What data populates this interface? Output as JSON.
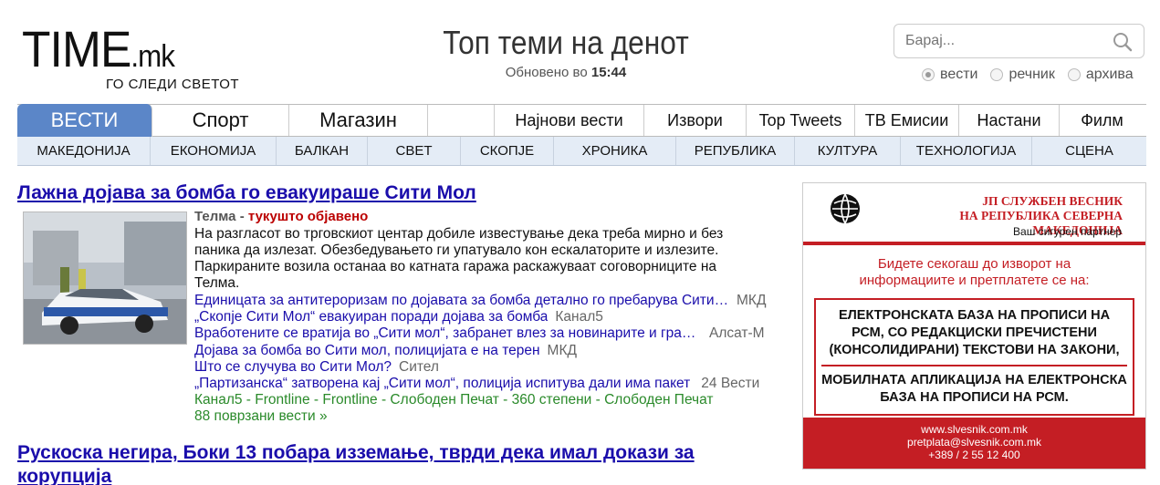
{
  "header": {
    "logo_main": "TIME",
    "logo_mk": ".mk",
    "logo_tagline": "ГО СЛЕДИ СВЕТОТ",
    "page_title": "Топ теми на денот",
    "updated_label": "Обновено во",
    "updated_time": "15:44",
    "search_placeholder": "Барај...",
    "radio_news": "вести",
    "radio_dictionary": "речник",
    "radio_archive": "архива"
  },
  "nav": {
    "main": [
      "ВЕСТИ",
      "Спорт",
      "Магазин"
    ],
    "secondary": [
      "Најнови вести",
      "Извори",
      "Top Tweets",
      "ТВ Емисии",
      "Настани",
      "Филм"
    ],
    "sub": [
      "МАКЕДОНИЈА",
      "ЕКОНОМИЈА",
      "БАЛКАН",
      "СВЕТ",
      "СКОПЈЕ",
      "ХРОНИКА",
      "РЕПУБЛИКА",
      "КУЛТУРА",
      "ТЕХНОЛОГИЈА",
      "СЦЕНА"
    ]
  },
  "article1": {
    "headline": "Лажна дојава за бомба го евакуираше Сити Мол",
    "source": "Телма",
    "source_sep": " - ",
    "recency": "тукушто објавено",
    "summary": "На разгласот во трговскиот центар добиле известување дека треба мирно и без паника да излезат. Обезбедувањето ги упатувало кон ескалаторите и излезите. Паркираните возила останаа во катната гаража раскажуваат соговорниците на Телма.",
    "related": [
      {
        "title": "Единицата за антитероризам по дојавата за бомба детално го пребарува Сити Мол",
        "source": "МКД"
      },
      {
        "title": "„Скопје Сити Мол“ евакуиран поради дојава за бомба",
        "source": "Канал5"
      },
      {
        "title": "Вработените се вратија во „Сити мол“, забранет влез за новинарите и граѓаните",
        "source": "Алсат-М"
      },
      {
        "title": "Дојава за бомба во Сити мол, полицијата е на терен",
        "source": "МКД"
      },
      {
        "title": "Што се случува во Сити Мол?",
        "source": "Сител"
      },
      {
        "title": "„Партизанска“ затворена кај „Сити мол“, полиција испитува дали има пакет",
        "source": "24 Вести"
      }
    ],
    "more_sources": "Канал5 - Frontline - Frontline - Слободен Печат - 360 степени - Слободен Печат",
    "more_count": "88 поврзани вести »",
    "thumb_label": "ПОЛИЦИЈА"
  },
  "article2": {
    "headline": "Рускоска негира, Боки 13 побара изземање, тврди дека имал докази за корупција"
  },
  "ad": {
    "title_line1": "ЈП СЛУЖБЕН ВЕСНИК",
    "title_line2": "НА РЕПУБЛИКА СЕВЕРНА МАКЕДОНИЈА",
    "slogan": "Ваш сигурен партнер",
    "red_line1": "Бидете секогаш до изворот на",
    "red_line2": "информациите и претплатете се на:",
    "box_text1": "ЕЛЕКТРОНСКАТА БАЗА НА ПРОПИСИ НА РСМ, СО РЕДАКЦИСКИ ПРЕЧИСТЕНИ (КОНСОЛИДИРАНИ) ТЕКСТОВИ НА ЗАКОНИ,",
    "box_text2": "МОБИЛНАТА АПЛИКАЦИЈА НА ЕЛЕКТРОНСКА БАЗА НА ПРОПИСИ НА РСМ.",
    "web": "www.slvesnik.com.mk",
    "email": "pretplata@slvesnik.com.mk",
    "phone": "+389 / 2 55 12 400"
  },
  "colors": {
    "nav_active": "#5b86c8",
    "link": "#1a0dab",
    "ad_red": "#c41e24",
    "sources_green": "#2a8a2a"
  }
}
